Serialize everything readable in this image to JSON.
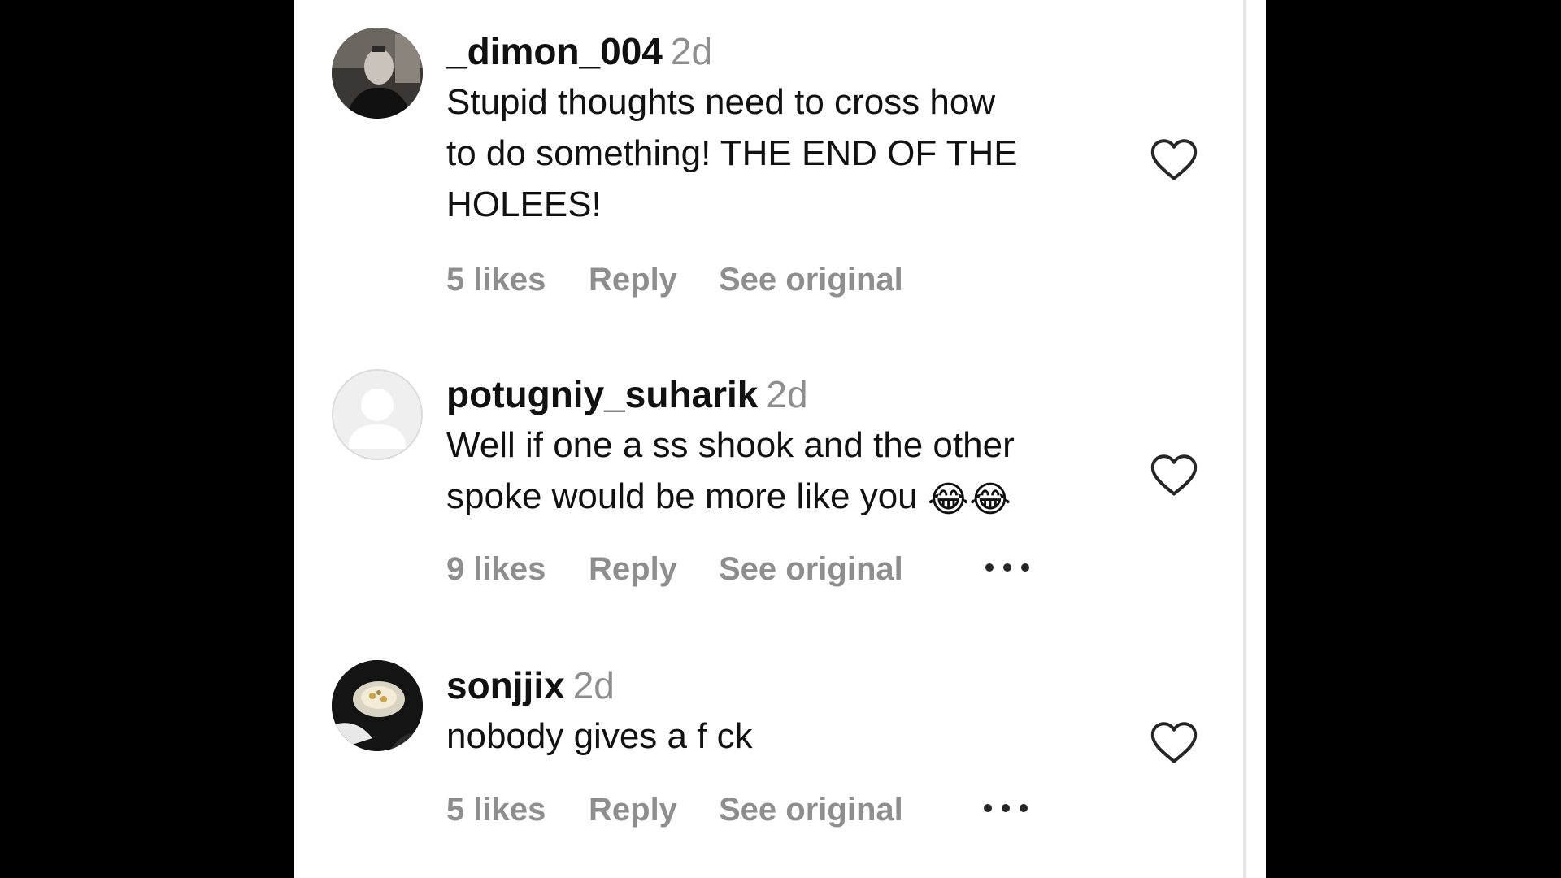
{
  "comments": [
    {
      "username": "_dimon_004",
      "time": "2d",
      "text_lines": [
        "Stupid thoughts need to cross how",
        "to do something! THE END OF THE",
        "HOLEES!"
      ],
      "likes": "5 likes",
      "reply": "Reply",
      "see_original": "See original",
      "avatar": "photo-avatar-dark",
      "has_more": false
    },
    {
      "username": "potugniy_suharik",
      "time": "2d",
      "text_lines": [
        "Well if one a ss shook and the other",
        "spoke would be more like you"
      ],
      "emoji": "😂😂",
      "likes": "9 likes",
      "reply": "Reply",
      "see_original": "See original",
      "avatar": "default-user-avatar",
      "has_more": true
    },
    {
      "username": "sonjjix",
      "time": "2d",
      "text_lines": [
        "nobody gives a f ck"
      ],
      "likes": "5 likes",
      "reply": "Reply",
      "see_original": "See original",
      "avatar": "photo-avatar-food",
      "has_more": true
    }
  ],
  "icons": {
    "like": "heart-outline-icon",
    "more": "more-horizontal-icon"
  },
  "colors": {
    "text": "#111111",
    "muted": "#8e8e8e",
    "background": "#ffffff",
    "outer": "#000000"
  }
}
